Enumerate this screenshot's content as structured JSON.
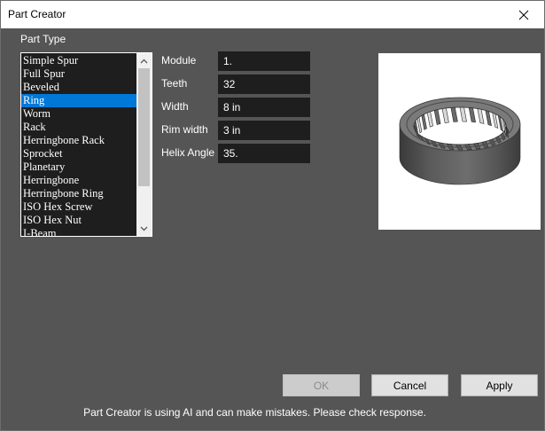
{
  "window": {
    "title": "Part Creator",
    "close_glyph": "close-icon"
  },
  "part_type": {
    "label": "Part Type",
    "selected": "Ring",
    "items": [
      "Simple Spur",
      "Full Spur",
      "Beveled",
      "Ring",
      "Worm",
      "Rack",
      "Herringbone Rack",
      "Sprocket",
      "Planetary",
      "Herringbone",
      "Herringbone Ring",
      "ISO Hex Screw",
      "ISO Hex Nut",
      "I-Beam"
    ]
  },
  "fields": [
    {
      "label": "Module",
      "value": "1."
    },
    {
      "label": "Teeth",
      "value": "32"
    },
    {
      "label": "Width",
      "value": "8 in"
    },
    {
      "label": "Rim width",
      "value": "3 in"
    },
    {
      "label": "Helix Angle",
      "value": "35."
    }
  ],
  "buttons": {
    "ok": "OK",
    "cancel": "Cancel",
    "apply": "Apply"
  },
  "status": "Part Creator is using AI and can make mistakes. Please check response.",
  "colors": {
    "selection": "#0078d7",
    "panel": "#555555",
    "field_bg": "#1e1e1e"
  }
}
